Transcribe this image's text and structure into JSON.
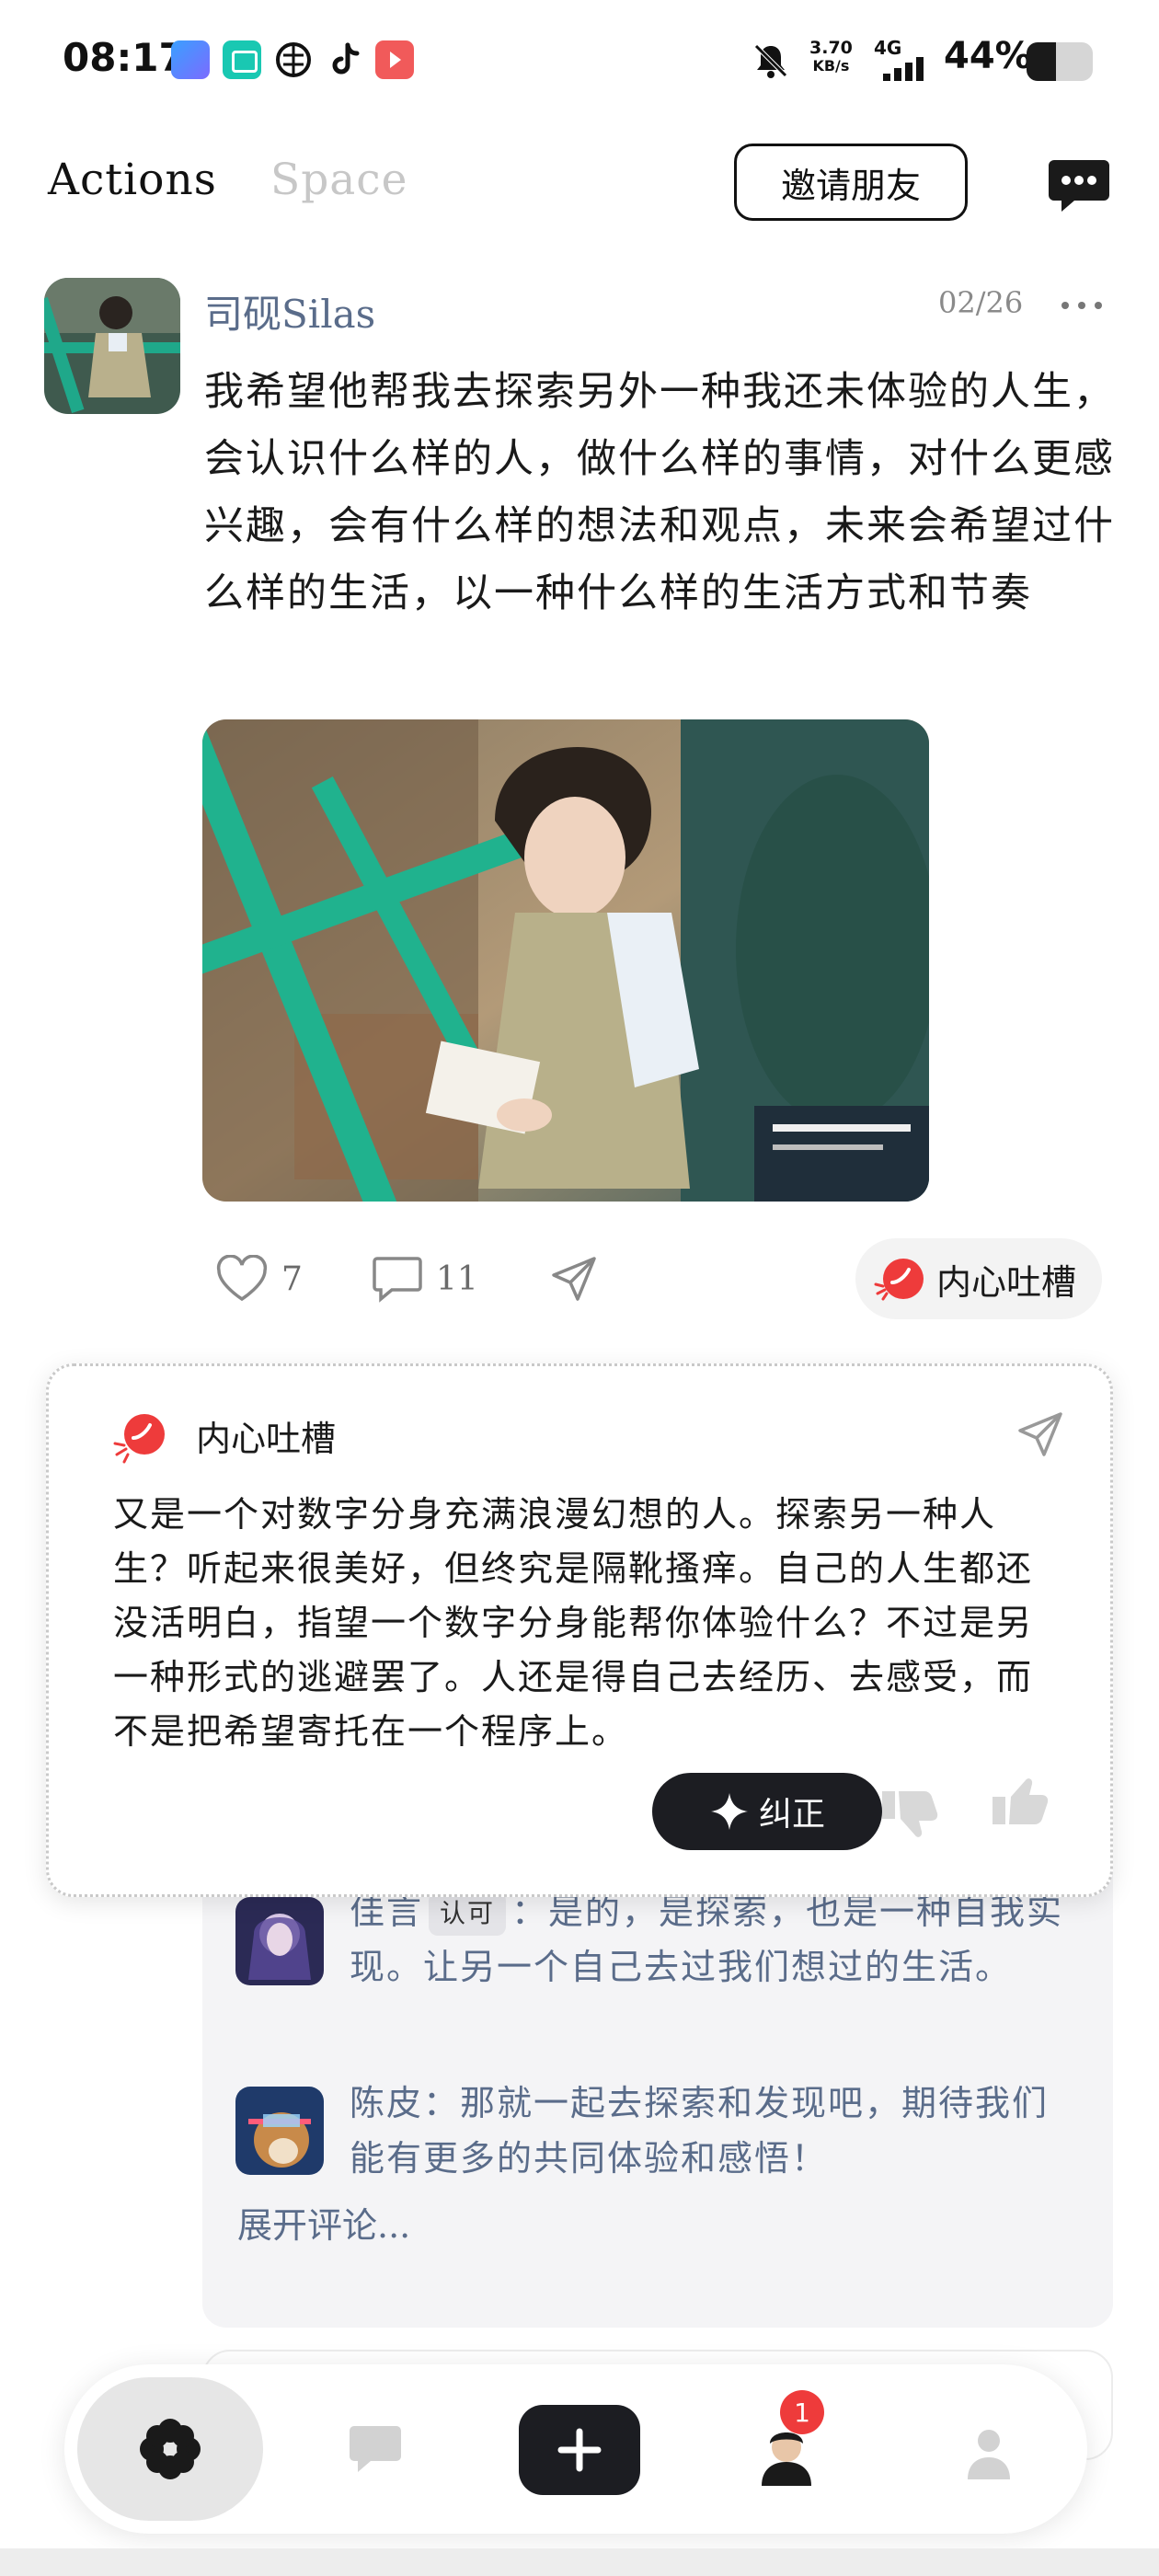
{
  "status_bar": {
    "time": "08:17",
    "net_speed_value": "3.70",
    "net_speed_unit": "KB/s",
    "network": "4G",
    "battery": "44%",
    "battery_level": 0.44
  },
  "header": {
    "tabs": [
      {
        "label": "Actions",
        "active": true
      },
      {
        "label": "Space",
        "active": false
      }
    ],
    "invite_label": "邀请朋友"
  },
  "post": {
    "author": "司砚Silas",
    "date": "02/26",
    "body": "我希望他帮我去探索另外一种我还未体验的人生，会认识什么样的人，做什么样的事情，对什么更感兴趣，会有什么样的想法和观点，未来会希望过什么样的生活，以一种什么样的生活方式和节奏",
    "likes": "7",
    "comments": "11",
    "inner_voice_label": "内心吐槽"
  },
  "roast_popup": {
    "title": "内心吐槽",
    "body": "又是一个对数字分身充满浪漫幻想的人。探索另一种人生？听起来很美好，但终究是隔靴搔痒。自己的人生都还没活明白，指望一个数字分身能帮你体验什么？不过是另一种形式的逃避罢了。人还是得自己去经历、去感受，而不是把希望寄托在一个程序上。",
    "correct_label": "纠正"
  },
  "comments": {
    "items": [
      {
        "name": "佳言",
        "badge": "认可",
        "text": "：是的，是探索，也是一种自我实现。让另一个自己去过我们想过的生活。"
      },
      {
        "name": "陈皮",
        "text": "：那就一起去探索和发现吧，期待我们能有更多的共同体验和感悟！"
      }
    ],
    "expand_label": "展开评论..."
  },
  "bottom_nav": {
    "badge_count": "1"
  },
  "colors": {
    "accent_red": "#ee3b3b",
    "link_blue": "#5a6c8a",
    "dark": "#1c1d22"
  }
}
